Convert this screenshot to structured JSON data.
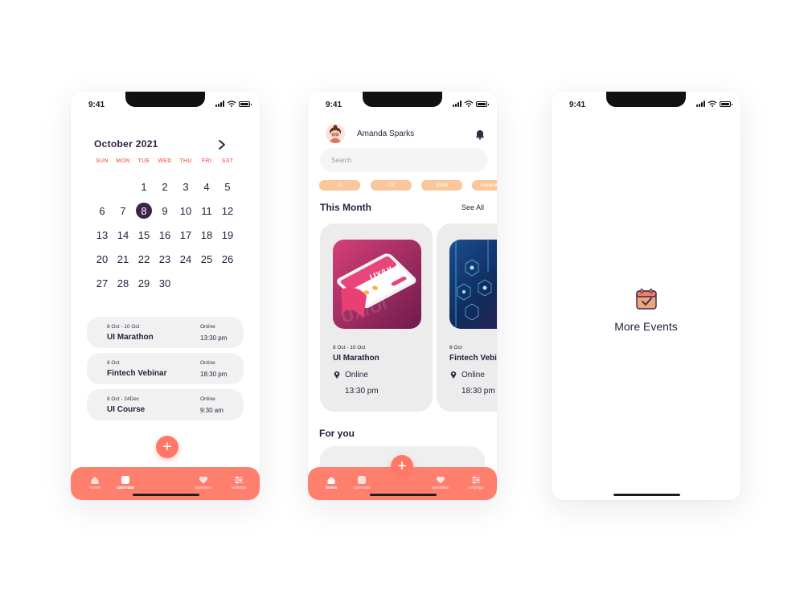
{
  "status": {
    "time": "9:41"
  },
  "calendar_screen": {
    "month": "October 2021",
    "weekdays": [
      "SUN",
      "MON",
      "TUE",
      "WED",
      "THU",
      "FRI",
      "SAT"
    ],
    "days": [
      "",
      "",
      "",
      "",
      "",
      "",
      "",
      "",
      "",
      "",
      "",
      "",
      "",
      "",
      "",
      "",
      "",
      "",
      "",
      "",
      "",
      "",
      "",
      "",
      "",
      "",
      "",
      "",
      "",
      "",
      "",
      "",
      "",
      "",
      "",
      "",
      "",
      "",
      "",
      "",
      "",
      "",
      "",
      "",
      "",
      "",
      "",
      ""
    ],
    "grid": [
      [
        "",
        "",
        "1",
        "2",
        "3",
        "4",
        "5"
      ],
      [
        "6",
        "7",
        "8",
        "9",
        "10",
        "11",
        "12"
      ],
      [
        "13",
        "14",
        "15",
        "16",
        "17",
        "18",
        "19"
      ],
      [
        "20",
        "21",
        "22",
        "23",
        "24",
        "25",
        "26"
      ],
      [
        "27",
        "28",
        "29",
        "30",
        "",
        "",
        ""
      ]
    ],
    "selected_day": "8",
    "events": [
      {
        "dates": "8 Oct - 10 Oct",
        "title": "UI Marathon",
        "location": "Online",
        "time": "13:30 pm"
      },
      {
        "dates": "8 Oct",
        "title": "Fintech Vebinar",
        "location": "Online",
        "time": "18:30 pm"
      },
      {
        "dates": "8 Oct - 24Dec",
        "title": "UI Course",
        "location": "Online",
        "time": "9:30 am"
      }
    ],
    "add_label": "+"
  },
  "home_screen": {
    "user_name": "Amanda Sparks",
    "search_placeholder": "Search",
    "chips": [
      "All",
      "UX",
      "SMM",
      "Inspiration"
    ],
    "this_month_title": "This Month",
    "see_all": "See All",
    "cards": [
      {
        "dates": "8 Oct - 10 Oct",
        "title": "UI Marathon",
        "location": "Online",
        "time": "13:30 pm",
        "image_text": "UX/UI"
      },
      {
        "dates": "8 Oct",
        "title": "Fintech Vebinar",
        "location": "Online",
        "time": "18:30 pm"
      }
    ],
    "for_you_title": "For you",
    "add_label": "+"
  },
  "more_screen": {
    "title": "More Events"
  },
  "tabbar": {
    "home": "home",
    "calendar": "calendar",
    "favorites": "favorites",
    "settings": "settings"
  },
  "colors": {
    "accent": "#ff7f6e",
    "dark_purple": "#3b2547",
    "chip": "#fbc79a",
    "card_bg": "#f1f1f1",
    "weekday": "#f07e6e"
  },
  "icons": {
    "next": "chevron-right-icon",
    "bell": "bell-icon",
    "pin": "location-pin-icon",
    "calendar_check": "calendar-check-icon",
    "home": "home-icon",
    "calendar": "calendar-icon",
    "favorites": "heart-icon",
    "settings": "sliders-icon"
  }
}
